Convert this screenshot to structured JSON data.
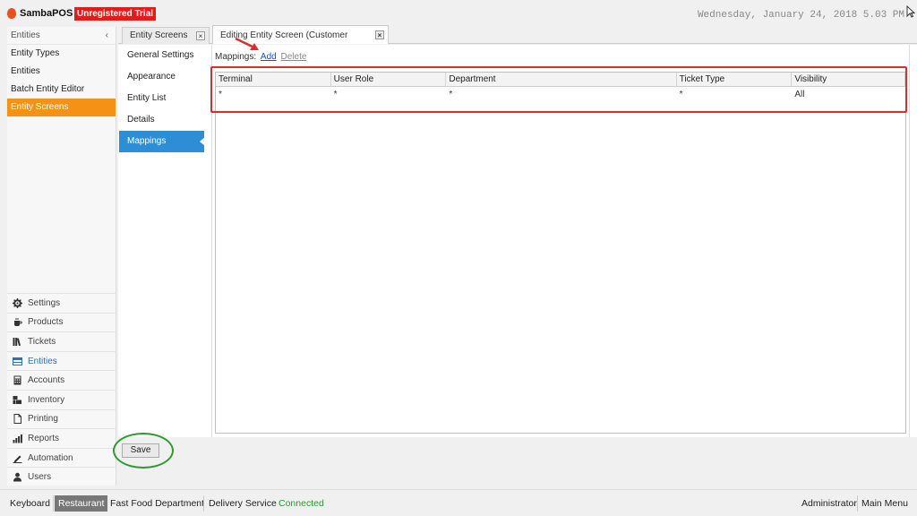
{
  "app": {
    "brand": "SambaPOS",
    "trial_badge": "Unregistered Trial",
    "datetime": "Wednesday, January 24, 2018 5.03 PM"
  },
  "leftnav": {
    "header": "Entities",
    "collapse_glyph": "‹",
    "items": [
      {
        "label": "Entity Types"
      },
      {
        "label": "Entities"
      },
      {
        "label": "Batch Entity Editor"
      },
      {
        "label": "Entity Screens"
      }
    ]
  },
  "modules": [
    {
      "label": "Settings",
      "icon": "gear-icon"
    },
    {
      "label": "Products",
      "icon": "coffee-icon"
    },
    {
      "label": "Tickets",
      "icon": "books-icon"
    },
    {
      "label": "Entities",
      "icon": "table-icon"
    },
    {
      "label": "Accounts",
      "icon": "calculator-icon"
    },
    {
      "label": "Inventory",
      "icon": "boxes-icon"
    },
    {
      "label": "Printing",
      "icon": "document-icon"
    },
    {
      "label": "Reports",
      "icon": "bar-chart-icon"
    },
    {
      "label": "Automation",
      "icon": "pen-icon"
    },
    {
      "label": "Users",
      "icon": "user-icon"
    }
  ],
  "tabs": [
    {
      "label": "Entity Screens"
    },
    {
      "label": "Editing Entity Screen (Customer Tickets)"
    }
  ],
  "subnav": [
    {
      "label": "General Settings"
    },
    {
      "label": "Appearance"
    },
    {
      "label": "Entity List"
    },
    {
      "label": "Details"
    },
    {
      "label": "Mappings"
    }
  ],
  "mappings": {
    "label": "Mappings:",
    "add": "Add",
    "delete": "Delete",
    "columns": [
      "Terminal",
      "User Role",
      "Department",
      "Ticket Type",
      "Visibility"
    ],
    "rows": [
      [
        "*",
        "*",
        "*",
        "*",
        "All"
      ]
    ]
  },
  "save_label": "Save",
  "statusbar": {
    "keyboard": "Keyboard",
    "restaurant": "Restaurant",
    "fast_food": "Fast Food Department",
    "delivery": "Delivery Service",
    "connected": "Connected",
    "user": "Administrator",
    "main_menu": "Main Menu"
  },
  "colors": {
    "accent_orange": "#f39214",
    "accent_blue": "#2d8ed6",
    "trial_red": "#e31b1b",
    "highlight_red": "#d92e2e",
    "highlight_green": "#2e9a2e",
    "connected_green": "#2a9a2a"
  }
}
